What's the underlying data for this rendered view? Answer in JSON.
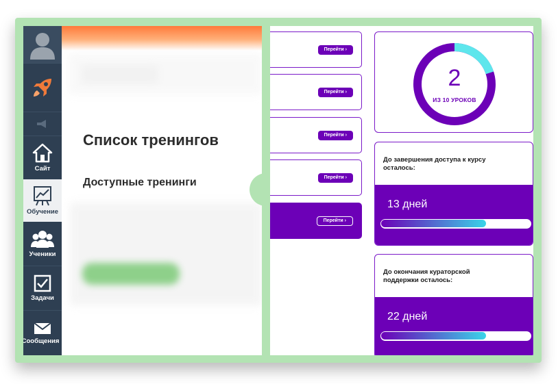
{
  "sidebar": {
    "items": [
      {
        "icon": "avatar-icon",
        "label": ""
      },
      {
        "icon": "rocket-icon",
        "label": ""
      },
      {
        "icon": "megaphone-icon",
        "label": ""
      },
      {
        "icon": "home-icon",
        "label": "Сайт"
      },
      {
        "icon": "chart-board-icon",
        "label": "Обучение"
      },
      {
        "icon": "users-icon",
        "label": "Ученики"
      },
      {
        "icon": "checkbox-icon",
        "label": "Задачи"
      },
      {
        "icon": "envelope-icon",
        "label": "Сообщения"
      }
    ]
  },
  "main": {
    "title": "Список тренингов",
    "subtitle": "Доступные тренинги"
  },
  "courses": {
    "button_label": "Перейти ›",
    "buttons": [
      "Перейти ›",
      "Перейти ›",
      "Перейти ›",
      "Перейти ›",
      "Перейти ›"
    ]
  },
  "progress": {
    "completed": "2",
    "caption": "ИЗ 10 УРОКОВ",
    "completed_value": 2,
    "total_value": 10
  },
  "access": {
    "label": "До завершения доступа к курсу осталось:",
    "value": "13 дней",
    "fill_fraction": 0.7
  },
  "support": {
    "label": "До окончания кураторской поддержки осталось:",
    "value": "22 дней",
    "fill_fraction": 0.7
  },
  "colors": {
    "accent_purple": "#6c00b7",
    "accent_cyan": "#3ad4e8",
    "frame_green": "#b3e3b3",
    "sidebar_dark": "#2e3f52",
    "brand_orange": "#ff7a3a"
  }
}
